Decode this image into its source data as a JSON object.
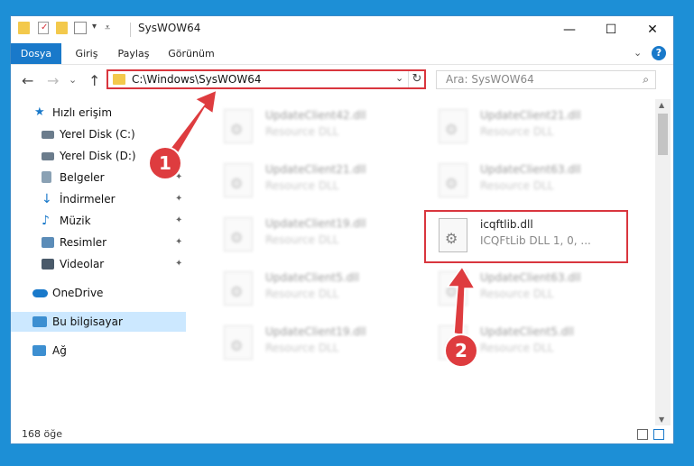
{
  "window": {
    "title": "SysWOW64",
    "minimize": "—",
    "maximize": "☐",
    "close": "✕"
  },
  "ribbon": {
    "tabs": [
      {
        "label": "Dosya",
        "active": true
      },
      {
        "label": "Giriş"
      },
      {
        "label": "Paylaş"
      },
      {
        "label": "Görünüm"
      }
    ],
    "collapse_glyph": "⌄",
    "help_glyph": "?"
  },
  "nav": {
    "back": "←",
    "forward": "→",
    "recent": "⌄",
    "up": "↑",
    "address": "C:\\Windows\\SysWOW64",
    "address_drop": "⌄",
    "refresh": "↻",
    "search_placeholder": "Ara: SysWOW64",
    "search_glyph": "⌕"
  },
  "sidebar": {
    "items": [
      {
        "label": "Hızlı erişim",
        "icon": "star-icon",
        "color": "#1979ca"
      },
      {
        "label": "Yerel Disk (C:)",
        "icon": "drive-icon",
        "color": "#6b7c8c",
        "pinned": true
      },
      {
        "label": "Yerel Disk (D:)",
        "icon": "drive-icon",
        "color": "#6b7c8c",
        "pinned": true
      },
      {
        "label": "Belgeler",
        "icon": "documents-icon",
        "color": "#8aa1b4",
        "pinned": true
      },
      {
        "label": "İndirmeler",
        "icon": "download-icon",
        "color": "#1979ca",
        "pinned": true
      },
      {
        "label": "Müzik",
        "icon": "music-icon",
        "color": "#1979ca",
        "pinned": true
      },
      {
        "label": "Resimler",
        "icon": "pictures-icon",
        "color": "#5b8cb8",
        "pinned": true
      },
      {
        "label": "Videolar",
        "icon": "videos-icon",
        "color": "#4a5a6a",
        "pinned": true
      },
      {
        "label": "OneDrive",
        "icon": "cloud-icon",
        "color": "#1979ca"
      },
      {
        "label": "Bu bilgisayar",
        "icon": "computer-icon",
        "color": "#3d8fd1",
        "selected": true
      },
      {
        "label": "Ağ",
        "icon": "network-icon",
        "color": "#3d8fd1"
      }
    ],
    "pin_glyph": "📌"
  },
  "files": [
    {
      "name": "UpdateClient42.dll",
      "desc": "Resource DLL",
      "blurred": true
    },
    {
      "name": "UpdateClient21.dll",
      "desc": "Resource DLL",
      "blurred": true
    },
    {
      "name": "UpdateClient21.dll",
      "desc": "Resource DLL",
      "blurred": true
    },
    {
      "name": "UpdateClient63.dll",
      "desc": "Resource DLL",
      "blurred": true
    },
    {
      "name": "UpdateClient19.dll",
      "desc": "Resource DLL",
      "blurred": true
    },
    {
      "name": "icqftlib.dll",
      "desc": "ICQFtLib DLL 1, 0, ...",
      "blurred": false
    },
    {
      "name": "UpdateClient5.dll",
      "desc": "Resource DLL",
      "blurred": true
    },
    {
      "name": "UpdateClient63.dll",
      "desc": "Resource DLL",
      "blurred": true
    },
    {
      "name": "UpdateClient19.dll",
      "desc": "Resource DLL",
      "blurred": true
    },
    {
      "name": "UpdateClient5.dll",
      "desc": "Resource DLL",
      "blurred": true
    }
  ],
  "status": {
    "count": "168 öğe"
  },
  "annotations": {
    "callout1": "1",
    "callout2": "2",
    "color": "#de3c3f"
  }
}
